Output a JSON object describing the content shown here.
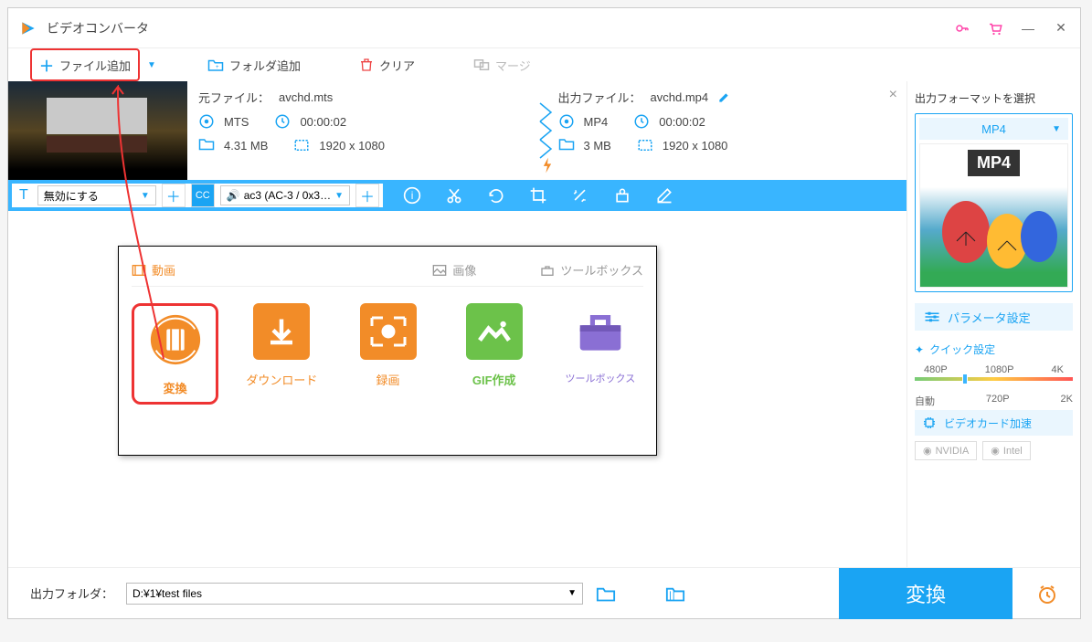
{
  "title": "ビデオコンバータ",
  "toolbar": {
    "add_file": "ファイル追加",
    "add_folder": "フォルダ追加",
    "clear": "クリア",
    "merge": "マージ"
  },
  "source": {
    "label": "元ファイル：",
    "filename": "avchd.mts",
    "format": "MTS",
    "duration": "00:00:02",
    "size": "4.31 MB",
    "resolution": "1920 x 1080"
  },
  "output": {
    "label": "出力ファイル：",
    "filename": "avchd.mp4",
    "format": "MP4",
    "duration": "00:00:02",
    "size": "3 MB",
    "resolution": "1920 x 1080"
  },
  "actionbar": {
    "subtitle_select": "無効にする",
    "audio_select": "ac3 (AC-3 / 0x3…"
  },
  "popup": {
    "tab_video": "動画",
    "tab_image": "画像",
    "tab_toolbox": "ツールボックス",
    "tiles": {
      "convert": "変換",
      "download": "ダウンロード",
      "record": "録画",
      "gif": "GIF作成",
      "toolbox": "ツールボックス"
    }
  },
  "rightpanel": {
    "header": "出力フォーマットを選択",
    "format_selected": "MP4",
    "preview_label": "MP4",
    "param_settings": "パラメータ設定",
    "quick_title": "クイック設定",
    "res_480": "480P",
    "res_1080": "1080P",
    "res_4k": "4K",
    "res_auto": "自動",
    "res_720": "720P",
    "res_2k": "2K",
    "gpu_accel": "ビデオカード加速",
    "nvidia": "NVIDIA",
    "intel": "Intel"
  },
  "bottom": {
    "label": "出力フォルダ：",
    "path": "D:¥1¥test files",
    "convert": "変換"
  },
  "colors": {
    "primary": "#1aa4f3",
    "accent": "#f28c28",
    "highlight": "#e33"
  }
}
